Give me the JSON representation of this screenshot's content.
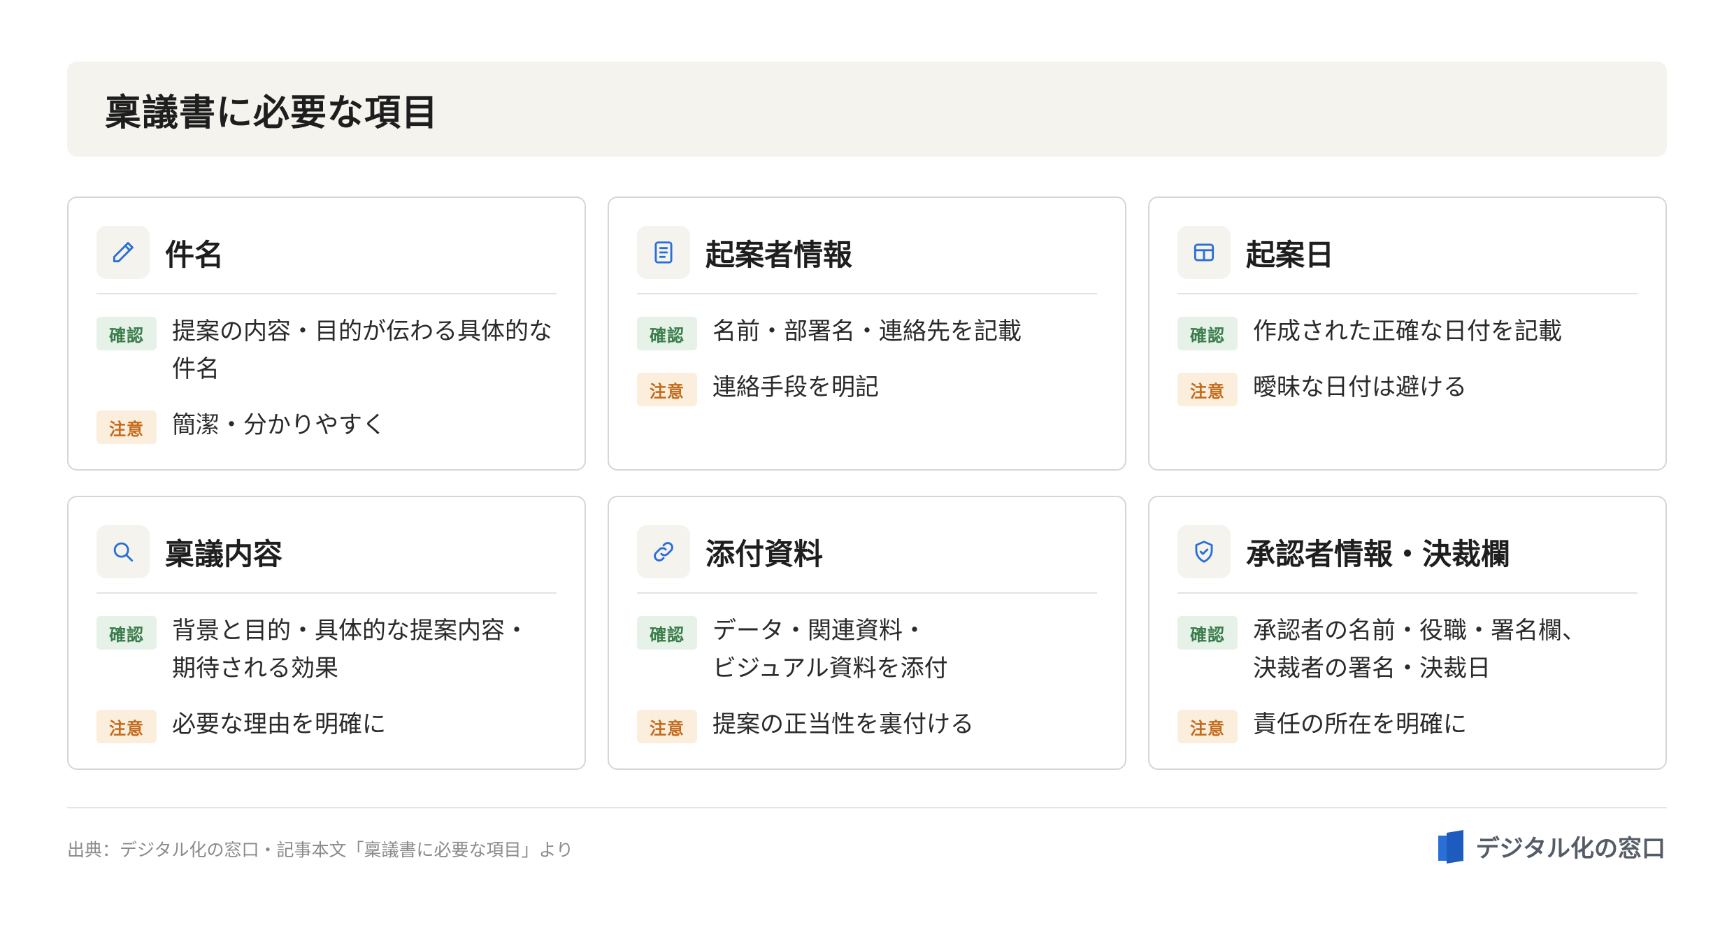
{
  "header": {
    "title": "稟議書に必要な項目"
  },
  "badges": {
    "confirm": "確認",
    "caution": "注意"
  },
  "colors": {
    "accent_blue": "#2a6fd6",
    "confirm_bg": "#e6f1e8",
    "confirm_text": "#3a7d4a",
    "caution_bg": "#fbeedd",
    "caution_text": "#c46a1b",
    "header_bg": "#f5f3ee"
  },
  "cards": [
    {
      "icon": "pencil-icon",
      "title": "件名",
      "confirm": "提案の内容・目的が伝わる具体的な\n件名",
      "caution": "簡潔・分かりやすく"
    },
    {
      "icon": "document-icon",
      "title": "起案者情報",
      "confirm": "名前・部署名・連絡先を記載",
      "caution": "連絡手段を明記"
    },
    {
      "icon": "calendar-grid-icon",
      "title": "起案日",
      "confirm": "作成された正確な日付を記載",
      "caution": "曖昧な日付は避ける"
    },
    {
      "icon": "search-icon",
      "title": "稟議内容",
      "confirm": "背景と目的・具体的な提案内容・\n期待される効果",
      "caution": "必要な理由を明確に"
    },
    {
      "icon": "link-icon",
      "title": "添付資料",
      "confirm": "データ・関連資料・\nビジュアル資料を添付",
      "caution": "提案の正当性を裏付ける"
    },
    {
      "icon": "shield-check-icon",
      "title": "承認者情報・決裁欄",
      "confirm": "承認者の名前・役職・署名欄、\n決裁者の署名・決裁日",
      "caution": "責任の所在を明確に"
    }
  ],
  "footer": {
    "source": "出典：デジタル化の窓口・記事本文「稟議書に必要な項目」より",
    "brand": "デジタル化の窓口"
  }
}
